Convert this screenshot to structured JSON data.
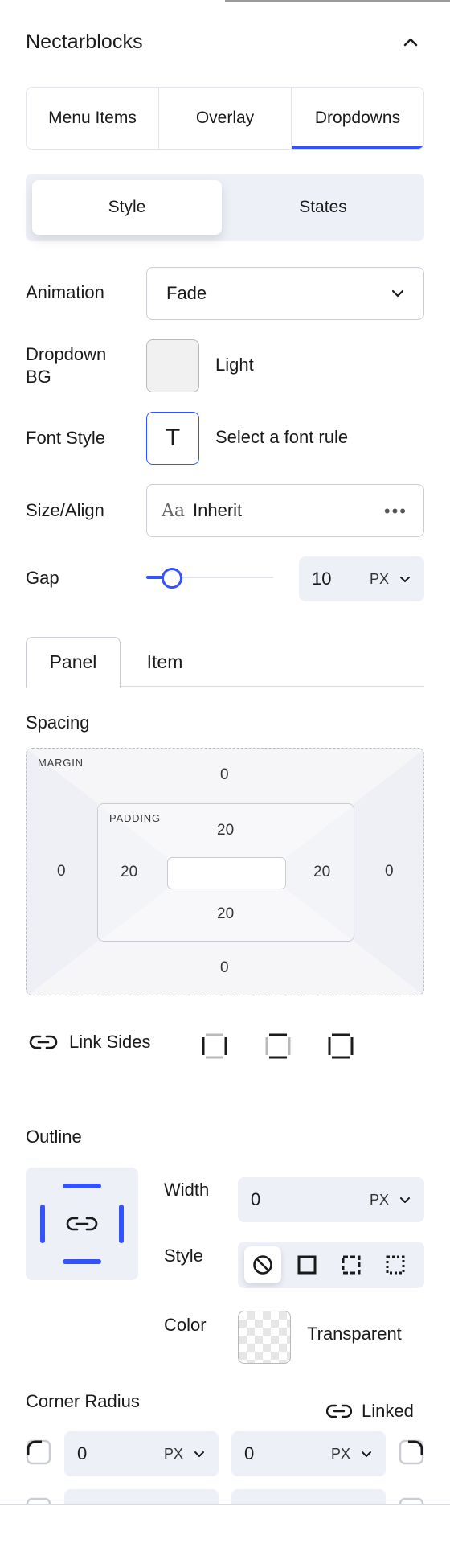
{
  "panel": {
    "title": "Nectarblocks"
  },
  "main_tabs": [
    {
      "label": "Menu Items"
    },
    {
      "label": "Overlay"
    },
    {
      "label": "Dropdowns"
    }
  ],
  "style_states": [
    {
      "label": "Style"
    },
    {
      "label": "States"
    }
  ],
  "animation": {
    "label": "Animation",
    "value": "Fade"
  },
  "dropdown_bg": {
    "label_line1": "Dropdown",
    "label_line2": "BG",
    "value": "Light"
  },
  "font_style": {
    "label": "Font Style",
    "glyph": "T",
    "value": "Select a font rule"
  },
  "size_align": {
    "label": "Size/Align",
    "glyph": "Aa",
    "value": "Inherit",
    "more": "•••"
  },
  "gap": {
    "label": "Gap",
    "value": "10",
    "unit": "PX",
    "slider_fraction": 0.2
  },
  "panel_tabs": [
    {
      "label": "Panel"
    },
    {
      "label": "Item"
    }
  ],
  "spacing": {
    "title": "Spacing",
    "margin_label": "MARGIN",
    "padding_label": "PADDING",
    "margin": {
      "top": "0",
      "right": "0",
      "bottom": "0",
      "left": "0"
    },
    "padding": {
      "top": "20",
      "right": "20",
      "bottom": "20",
      "left": "20"
    }
  },
  "link_sides": {
    "label": "Link Sides"
  },
  "outline": {
    "title": "Outline",
    "width_label": "Width",
    "width_value": "0",
    "width_unit": "PX",
    "style_label": "Style",
    "color_label": "Color",
    "color_value": "Transparent"
  },
  "corner_radius": {
    "title": "Corner Radius",
    "linked_label": "Linked",
    "top_left": "0",
    "top_right": "0",
    "unit": "PX"
  },
  "colors": {
    "accent": "#3452ff",
    "panel_bg": "#eef0f8",
    "border": "#c9ccd2"
  }
}
